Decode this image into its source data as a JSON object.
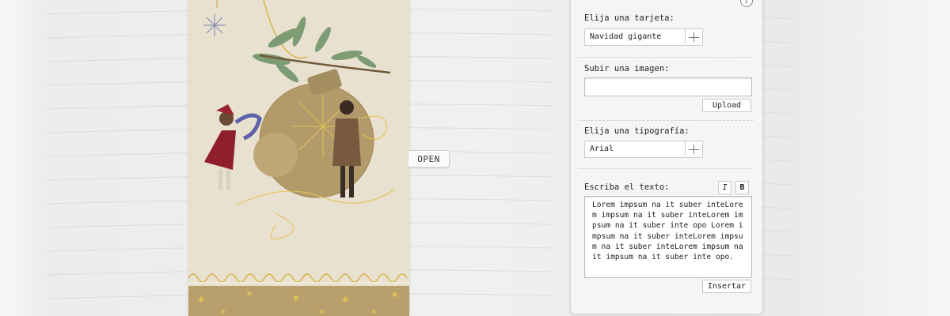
{
  "open_tab": {
    "label": "OPEN"
  },
  "panel": {
    "info_icon": "info-icon",
    "card_section": {
      "label": "Elija una tarjeta:",
      "value": "Navidad gigante"
    },
    "image_section": {
      "label": "Subir una imagen:",
      "upload_label": "Upload"
    },
    "font_section": {
      "label": "Elija una tipografía:",
      "value": "Arial"
    },
    "text_section": {
      "label": "Escriba el texto:",
      "italic_label": "I",
      "bold_label": "B",
      "text": "Lorem impsum na it suber inteLorem impsum na it suber inteLorem impsum na it suber inte opo Lorem impsum na it suber inteLorem impsum na it suber inteLorem impsum na it impsum na it suber inte opo.",
      "insert_label": "Insertar"
    }
  },
  "colors": {
    "card_background": "#e9e1cf",
    "ornament_gold": "#b39a6a",
    "gold_line": "#d4a929",
    "panel_background": "#f5f5f5"
  }
}
